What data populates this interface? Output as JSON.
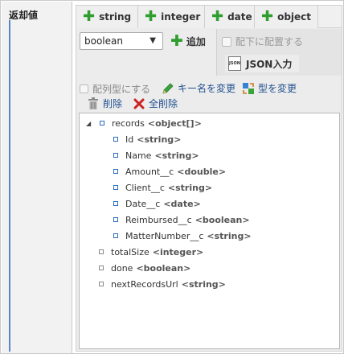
{
  "section": {
    "label": "返却値"
  },
  "tabs": [
    {
      "label": "string"
    },
    {
      "label": "integer"
    },
    {
      "label": "date"
    },
    {
      "label": "object"
    }
  ],
  "controls": {
    "type_select_value": "boolean",
    "add_label": "追加",
    "place_under_label": "配下に配置する",
    "json_input_label": "JSON入力",
    "json_icon_text": "JSON"
  },
  "toolbar": {
    "array_type_label": "配列型にする",
    "rename_key_label": "キー名を変更",
    "change_type_label": "型を変更",
    "delete_label": "削除",
    "delete_all_label": "全削除"
  },
  "tree": {
    "nodes": [
      {
        "name": "records",
        "type": "<object[]>",
        "expanded": true
      },
      {
        "name": "Id",
        "type": "<string>"
      },
      {
        "name": "Name",
        "type": "<string>"
      },
      {
        "name": "Amount__c",
        "type": "<double>"
      },
      {
        "name": "Client__c",
        "type": "<string>"
      },
      {
        "name": "Date__c",
        "type": "<date>"
      },
      {
        "name": "Reimbursed__c",
        "type": "<boolean>"
      },
      {
        "name": "MatterNumber__c",
        "type": "<string>"
      },
      {
        "name": "totalSize",
        "type": "<integer>"
      },
      {
        "name": "done",
        "type": "<boolean>"
      },
      {
        "name": "nextRecordsUrl",
        "type": "<string>"
      }
    ]
  },
  "colors": {
    "plus_green": "#2f9e2f",
    "link_blue": "#1f4f8f",
    "delete_red": "#cc2222",
    "node_blue": "#2b6fbf"
  }
}
